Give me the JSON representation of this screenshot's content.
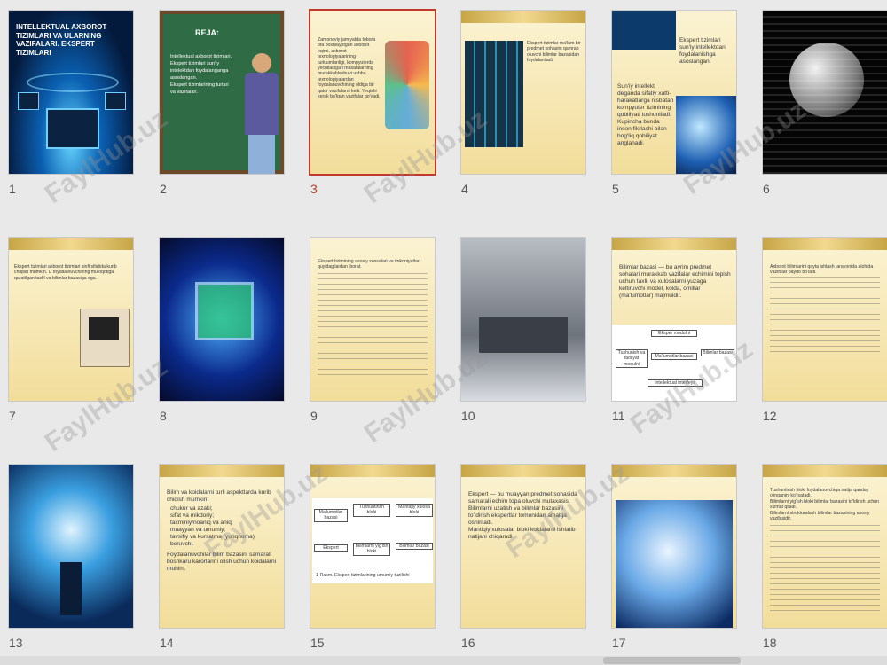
{
  "slides": [
    {
      "number": "1",
      "title": "INTELLEKTUAL AXBOROT TIZIMLARI VA ULARNING VAZIFALARI. EKSPERT TIZIMLARI"
    },
    {
      "number": "2",
      "heading": "REJA:",
      "items": [
        "Intellektual axborot tizimlari.",
        "Ekspert tizimlari sun'iy intelektdan foydalanganga asoslangan.",
        "Ekspert tizimlarining turlari va vazifalari."
      ]
    },
    {
      "number": "3",
      "text": "Zamonaviy jamiyatda tobora ota boshlayotgan axborot oqimi, axborot texnologiyalarining turkiumlanligi, kompyuterda yechiladigan masalalarning murakkablashuvi ushbu texnologiyalardan foydalanuvchining oldiga bir qator vazifalarni kelti. Yeqishi kerak bo'lgan vazifalar qo'yadi."
    },
    {
      "number": "4",
      "text": "Ekspert tizimlar ma'lum bir predmet sohasini qamrab oluvchi bilimlar bazasidan foydalaniladi."
    },
    {
      "number": "5",
      "text": "Ekspert tizimlari sun'iy intellektdan foydalanishga asoslangan.",
      "text2": "Sun'iy intellekt deganda sifatiy xatti-harakatlarga nisbatan kompyuter tizimining qobiliyati tushuniladi. Kupincha bunda inson fikrlashi bilan bog'liq qobiliyat anglanadi."
    },
    {
      "number": "6"
    },
    {
      "number": "7",
      "text": "Ekspert tizimlari axborot tizimlari sinfi sifatida kurib chiqish mumkin. U foydalanuvchining muloqotiga qaratilgan taxlil va bilimlar bazasiga ega."
    },
    {
      "number": "8"
    },
    {
      "number": "9",
      "text": "Ekspert tizimining asosiy xossalari va imkoniyatlari quyidagilardan iborat."
    },
    {
      "number": "10"
    },
    {
      "number": "11",
      "text": "Bilimlar bazasi — bu ayrim predmet sohalari murakkab vazifalar echimini topish uchun taxlil va xulosalarni yuzaga keltiruvchi model, koida, omillar (ma'lumotlar) majmuidir.",
      "boxes": [
        "Eksper modulni",
        "Tushunish va faoliyat modulni",
        "Ma'lumotlar bazasi",
        "Bilimlar bazasi",
        "Intellektual interfeys"
      ]
    },
    {
      "number": "12",
      "text": "Axborot bilimlarini qayta ishlash jarayonida alohida vazifalar paydo bo'ladi."
    },
    {
      "number": "13"
    },
    {
      "number": "14",
      "text": "Bilim va koidalarni turli aspektlarda kurib chiqish mumkin:",
      "items": [
        "chukur va azaki;",
        "sifat va mikdoriy;",
        "taxminiy/noaniq va aniq;",
        "muayyan va umumiy;",
        "tavsifiy va kursatma (yuriqnoma) beruvchi."
      ],
      "text2": "Foydalanuvchilar bilim bazasini samarali boshkaru karorlarini olish uchun koidalarni muhim."
    },
    {
      "number": "15",
      "boxes": [
        "Ma'lumotlar bazasi",
        "Tushuntirish bloki",
        "Mantiqiy xulosa bloki",
        "Ekspert",
        "Bilimlarni yig'ish bloki",
        "Bilimlar bazasi"
      ],
      "caption": "1-Rasm. Ekspert tizimlarining umumiy tuzilishi"
    },
    {
      "number": "16",
      "items": [
        "Ekspert — bu muayyan predmet sohasida samarali echim topa oluvchi mutaxasis.",
        "Bilimlarni uzatish va bilimlar bazasini to'ldirish ekspertlar tomonidan amalga oshiriladi.",
        "Mantiqiy xulosalar bloki koidalarni ishlatib natijani chiqaradi."
      ]
    },
    {
      "number": "17"
    },
    {
      "number": "18",
      "items": [
        "Tushuntirish bloki foydalanuvchiga natija qanday olinganini ko'rsatadi.",
        "Bilimlarni yig'ish bloki bilimlar bazasini to'ldirish uchun xizmat qiladi.",
        "Bilimlarni strukturalash bilimlar bazasining asosiy vazifasidir."
      ]
    }
  ],
  "selected_slide": "3",
  "watermark": "FaylHub.uz",
  "icons": {
    "scrollbar": "horizontal-scrollbar"
  }
}
